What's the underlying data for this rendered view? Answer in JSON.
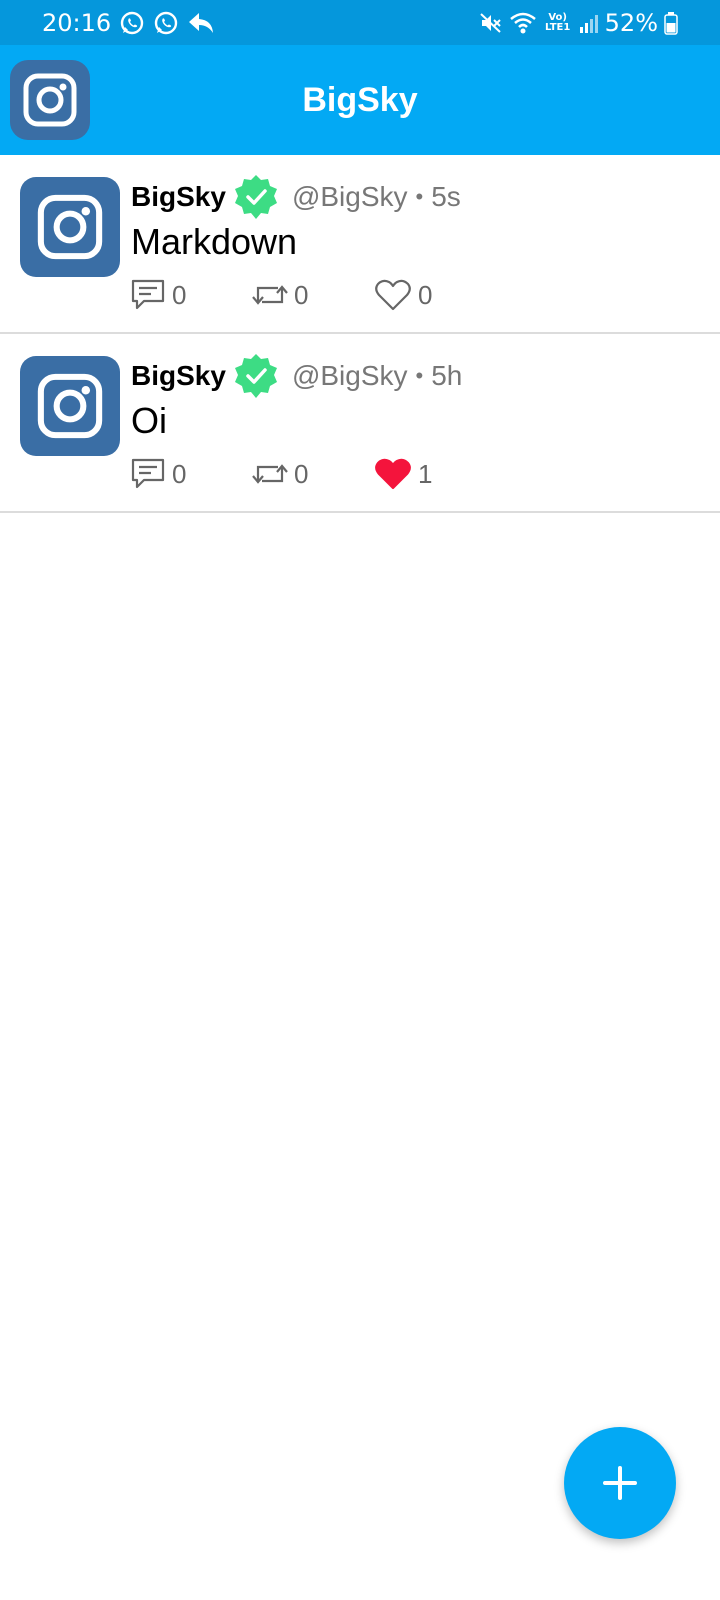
{
  "status_bar": {
    "time": "20:16",
    "battery_pct": "52%",
    "network_label": "Vo) LTE1"
  },
  "app_bar": {
    "title": "BigSky",
    "logo_icon": "instagram-logo-icon"
  },
  "posts": [
    {
      "author": "BigSky",
      "handle": "@BigSky",
      "separator": "•",
      "time": "5s",
      "text": "Markdown",
      "comments": "0",
      "reposts": "0",
      "likes": "0",
      "liked": false
    },
    {
      "author": "BigSky",
      "handle": "@BigSky",
      "separator": "•",
      "time": "5h",
      "text": "Oi",
      "comments": "0",
      "reposts": "0",
      "likes": "1",
      "liked": true
    }
  ],
  "colors": {
    "status_bar": "#0597dc",
    "app_bar": "#03a9f4",
    "avatar_bg": "#3a6ea5",
    "verified": "#3ddc84",
    "like_active": "#f4143c",
    "fab": "#03a9f4"
  },
  "fab": {
    "icon": "plus-icon"
  }
}
